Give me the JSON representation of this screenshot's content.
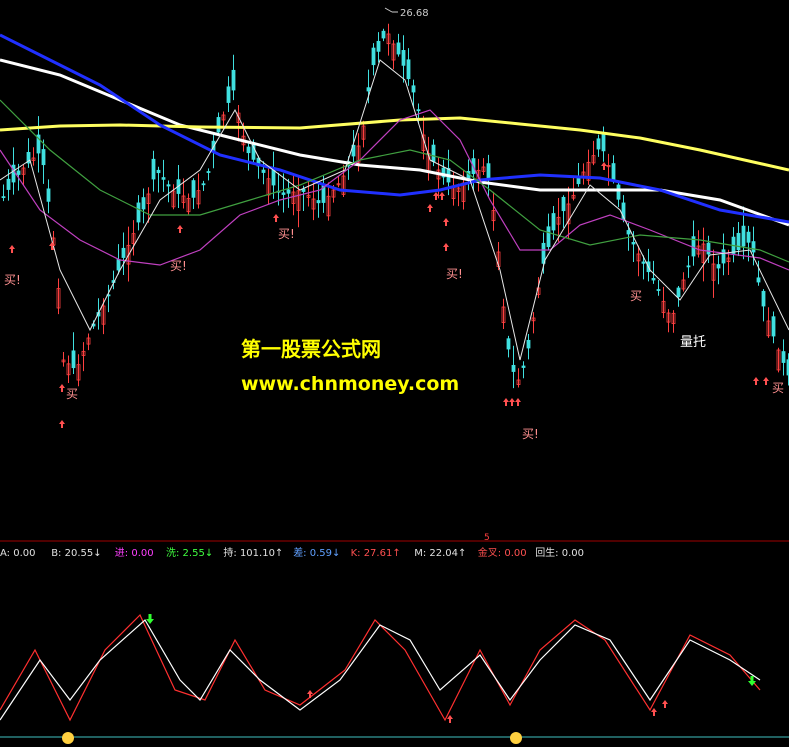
{
  "main_panel": {
    "high_label": "26.68",
    "signals": {
      "buy": "买!",
      "buy_short": "买",
      "volume_support": "量托"
    },
    "watermark": {
      "title": "第一股票公式网",
      "url": "www.chnmoney.com"
    }
  },
  "indicator_panel": {
    "panel_index": "5",
    "readouts": [
      {
        "label": "A:",
        "value": "0.00",
        "arrow": "",
        "color": "#e0e0e0"
      },
      {
        "label": "B:",
        "value": "20.55",
        "arrow": "↓",
        "color": "#e0e0e0"
      },
      {
        "label": "进:",
        "value": "0.00",
        "arrow": "",
        "color": "#ff40ff"
      },
      {
        "label": "洗:",
        "value": "2.55",
        "arrow": "↓",
        "color": "#40ff40"
      },
      {
        "label": "持:",
        "value": "101.10",
        "arrow": "↑",
        "color": "#e0e0e0"
      },
      {
        "label": "差:",
        "value": "0.59",
        "arrow": "↓",
        "color": "#60a0ff"
      },
      {
        "label": "K:",
        "value": "27.61",
        "arrow": "↑",
        "color": "#ff5050"
      },
      {
        "label": "M:",
        "value": "22.04",
        "arrow": "↑",
        "color": "#e0e0e0"
      },
      {
        "label": "金叉:",
        "value": "0.00",
        "arrow": "",
        "color": "#ff5050"
      },
      {
        "label": "回生:",
        "value": "0.00",
        "arrow": "",
        "color": "#e0e0e0"
      }
    ]
  },
  "colors": {
    "background": "#000000",
    "up_candle": "#ff4040",
    "down_candle": "#40e0e0",
    "ma_long_white": "#ffffff",
    "ma_yellow": "#ffff60",
    "ma_blue": "#2030ff",
    "ma_purple": "#c040c0",
    "ma_green": "#40a040",
    "divider": "#a00000",
    "watermark": "#ffff00"
  }
}
